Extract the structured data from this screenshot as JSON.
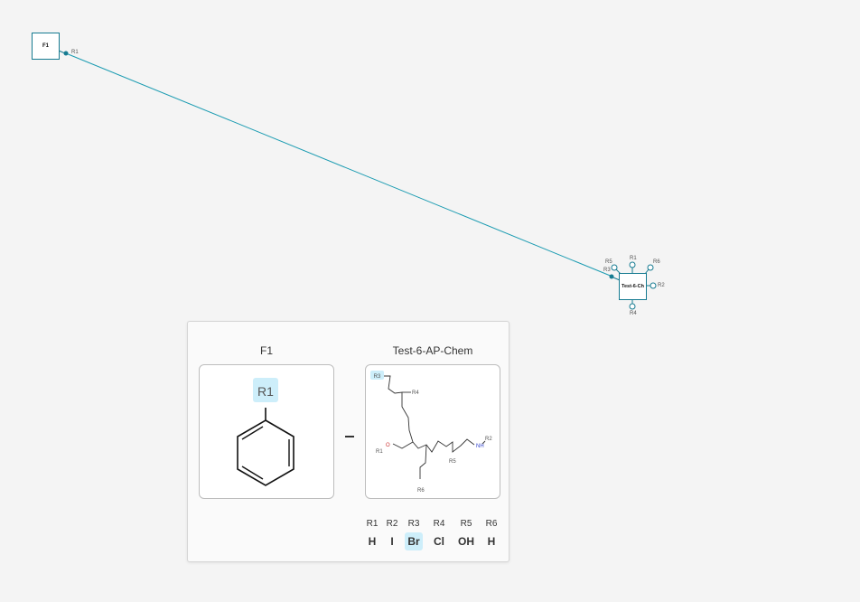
{
  "canvas": {
    "monomers": [
      {
        "id": "F1",
        "label": "F1",
        "attachments": [
          "R1"
        ]
      },
      {
        "id": "Test-6-Ch",
        "label": "Test-6-Ch",
        "attachments": [
          "R5",
          "R1",
          "R6",
          "R3",
          "R2",
          "R4"
        ]
      }
    ],
    "connection": {
      "from": "F1:R1",
      "to": "Test-6-Ch:R3"
    },
    "colors": {
      "bond": "#1a9bb1",
      "monomer_border": "#167b91",
      "background": "#f4f4f4"
    }
  },
  "preview": {
    "left": {
      "title": "F1",
      "r_label": "R1"
    },
    "right": {
      "title": "Test-6-AP-Chem",
      "labels": {
        "R3": "R3",
        "R4": "R4",
        "R1": "R1",
        "R2": "R2",
        "R5": "R5",
        "R6": "R6",
        "NH": "NH",
        "O": "O"
      }
    },
    "rgroups": [
      {
        "name": "R1",
        "value": "H",
        "highlight": false
      },
      {
        "name": "R2",
        "value": "I",
        "highlight": false
      },
      {
        "name": "R3",
        "value": "Br",
        "highlight": true
      },
      {
        "name": "R4",
        "value": "Cl",
        "highlight": false
      },
      {
        "name": "R5",
        "value": "OH",
        "highlight": false
      },
      {
        "name": "R6",
        "value": "H",
        "highlight": false
      }
    ],
    "colors": {
      "highlight": "#cdeefa",
      "heteroatom_N": "#3344cc",
      "heteroatom_O": "#cc3333"
    }
  }
}
